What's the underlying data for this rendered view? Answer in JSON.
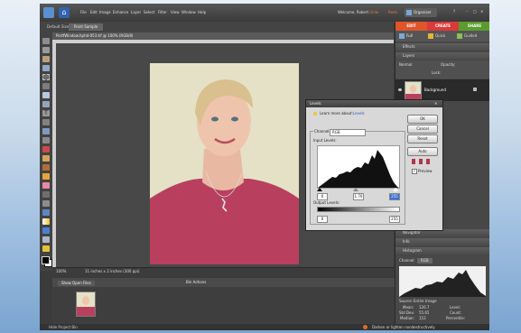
{
  "menubar": {
    "items": [
      "File",
      "Edit",
      "Image",
      "Enhance",
      "Layer",
      "Select",
      "Filter",
      "View",
      "Window",
      "Help"
    ],
    "welcome": "Welcome, Robert",
    "undo": "Undo",
    "redo": "Redo",
    "organizer": "Organizer"
  },
  "options_bar": {
    "tool_label": "Default Size",
    "tool_value": "Point Sample"
  },
  "document_tab": "PortfWindow.hphd-053.tif @ 100% (RGB/8)",
  "status": {
    "zoom": "100%",
    "info": "11 inches x 2 inches (300 ppi)",
    "hint": "Darken or lighten nondestructively"
  },
  "bin": {
    "dropdown": "Show Open Files",
    "actions": "Bin Actions"
  },
  "bottom": {
    "hide": "Hide Project Bin"
  },
  "panel": {
    "tabs": [
      {
        "label": "EDIT",
        "color": "#e0542a"
      },
      {
        "label": "CREATE",
        "color": "#d93a3a"
      },
      {
        "label": "SHARE",
        "color": "#5b9c2e"
      }
    ],
    "modes": [
      "Full",
      "Quick",
      "Guided"
    ],
    "effects": "Effects",
    "layers": "Layers",
    "blend": "Normal",
    "opacity_label": "Opacity:",
    "lock_label": "Lock:",
    "layer_name": "Background",
    "navigator": "Navigator",
    "info": "Info",
    "histogram": "Histogram",
    "hist_channel_label": "Channel:",
    "hist_channel_value": "RGB",
    "hist_source_label": "Source:",
    "hist_source_value": "Entire Image",
    "stats": [
      {
        "k": "Mean:",
        "v": "126.7",
        "k2": "Level:"
      },
      {
        "k": "Std Dev:",
        "v": "55.65",
        "k2": "Count:"
      },
      {
        "k": "Median:",
        "v": "153",
        "k2": "Percentile:"
      }
    ]
  },
  "levels_dialog": {
    "title": "Levels",
    "learn": "Learn more about:",
    "learn_link": "Levels",
    "channel_label": "Channel:",
    "channel_value": "RGB",
    "input_label": "Input Levels:",
    "input_values": [
      "0",
      "1.70",
      "255"
    ],
    "output_label": "Output Levels:",
    "output_values": [
      "0",
      "255"
    ],
    "buttons": [
      "OK",
      "Cancel",
      "Reset",
      "Auto"
    ],
    "preview": "Preview"
  }
}
